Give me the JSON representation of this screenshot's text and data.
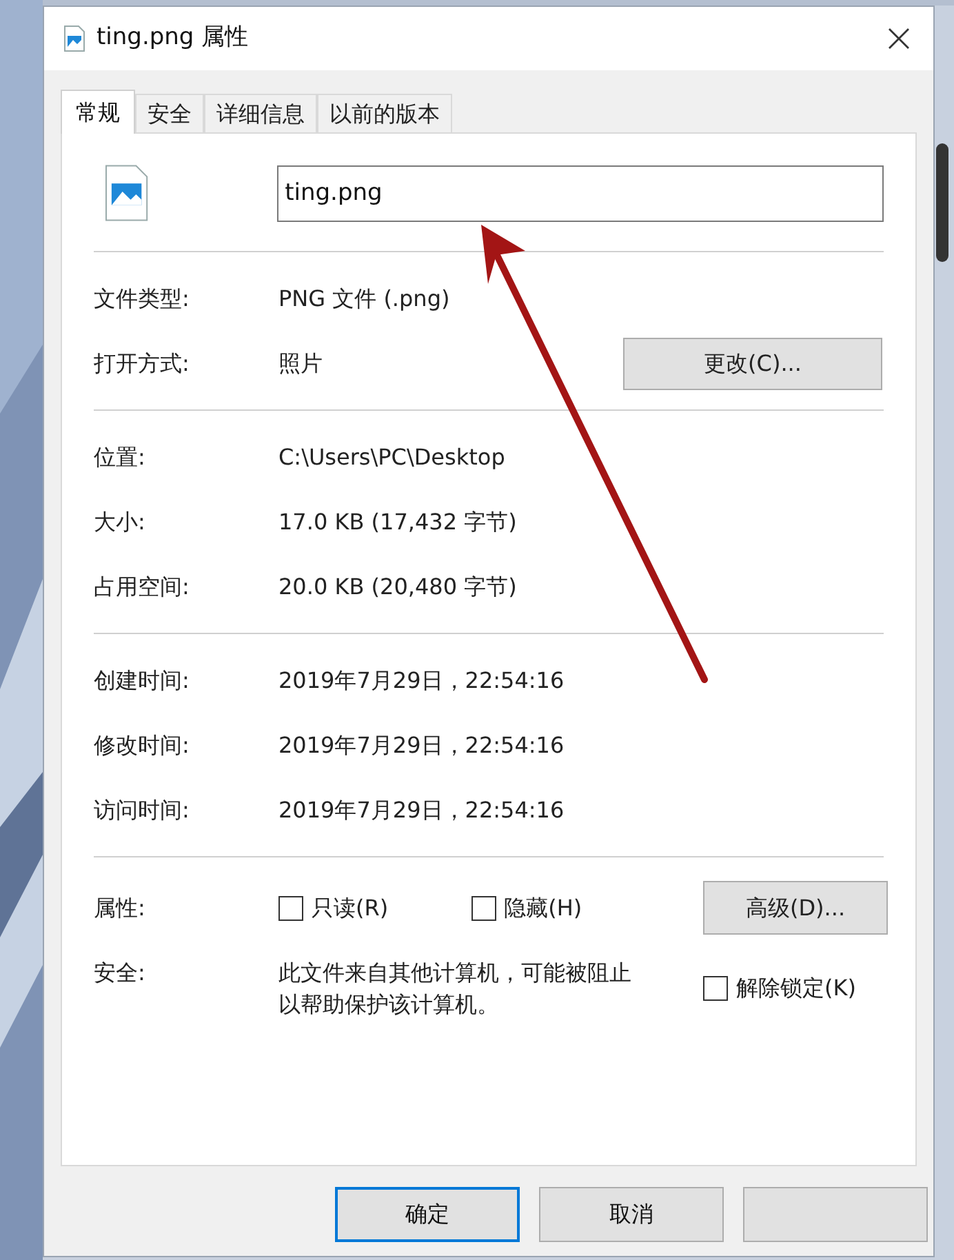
{
  "window": {
    "title": "ting.png 属性"
  },
  "tabs": [
    {
      "label": "常规",
      "selected": true
    },
    {
      "label": "安全",
      "selected": false
    },
    {
      "label": "详细信息",
      "selected": false
    },
    {
      "label": "以前的版本",
      "selected": false
    }
  ],
  "file_name": {
    "value": "ting.png"
  },
  "sections": [
    [
      {
        "label": "文件类型:",
        "value": "PNG 文件 (.png)"
      },
      {
        "label": "打开方式:",
        "value": "照片",
        "button": "更改(C)..."
      }
    ],
    [
      {
        "label": "位置:",
        "value": "C:\\Users\\PC\\Desktop"
      },
      {
        "label": "大小:",
        "value": "17.0 KB (17,432 字节)"
      },
      {
        "label": "占用空间:",
        "value": "20.0 KB (20,480 字节)"
      }
    ],
    [
      {
        "label": "创建时间:",
        "value": "2019年7月29日，22:54:16"
      },
      {
        "label": "修改时间:",
        "value": "2019年7月29日，22:54:16"
      },
      {
        "label": "访问时间:",
        "value": "2019年7月29日，22:54:16"
      }
    ]
  ],
  "attributes": {
    "label": "属性:",
    "checkboxes": [
      {
        "label": "只读(R)",
        "checked": false
      },
      {
        "label": "隐藏(H)",
        "checked": false
      }
    ],
    "button": "高级(D)..."
  },
  "security": {
    "label": "安全:",
    "text": "此文件来自其他计算机，可能被阻止以帮助保护该计算机。",
    "checkbox": {
      "label": "解除锁定(K)",
      "checked": false
    }
  },
  "buttons": [
    {
      "label": "确定",
      "default": true
    },
    {
      "label": "取消",
      "default": false
    }
  ]
}
